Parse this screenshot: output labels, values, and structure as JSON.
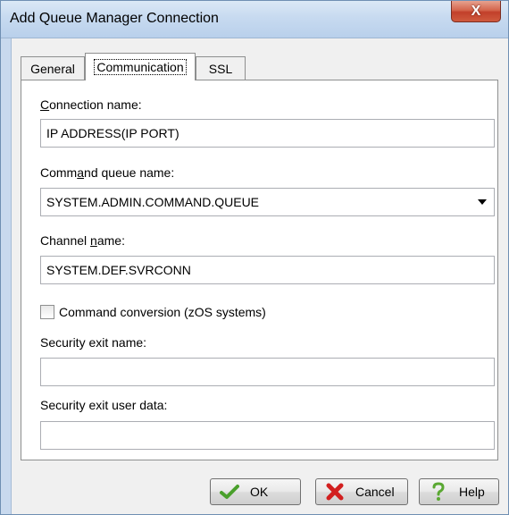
{
  "window": {
    "title": "Add Queue Manager Connection",
    "close_glyph": "X"
  },
  "tabs": [
    {
      "label": "General"
    },
    {
      "label": "Communication",
      "active": true
    },
    {
      "label": "SSL"
    }
  ],
  "form": {
    "connection_name": {
      "label_accel": "C",
      "label_rest": "onnection name:",
      "value": "IP ADDRESS(IP PORT)"
    },
    "command_queue": {
      "label_pre": "Comm",
      "label_accel": "a",
      "label_post": "nd queue name:",
      "value": "SYSTEM.ADMIN.COMMAND.QUEUE"
    },
    "channel_name": {
      "label_pre": "Channel ",
      "label_accel": "n",
      "label_post": "ame:",
      "value": "SYSTEM.DEF.SVRCONN"
    },
    "command_conversion": {
      "label": "Command conversion (zOS systems)",
      "checked": false
    },
    "security_exit_name": {
      "label": "Security exit name:",
      "value": ""
    },
    "security_exit_user_data": {
      "label": "Security exit user data:",
      "value": ""
    }
  },
  "buttons": {
    "ok": {
      "label": "OK",
      "icon": "checkmark-icon"
    },
    "cancel": {
      "label": "Cancel",
      "icon": "red-x-icon"
    },
    "help": {
      "label": "Help",
      "icon": "question-mark-icon"
    }
  },
  "colors": {
    "title_bar": "#c7daf0",
    "close_button": "#c2402a",
    "ok_icon": "#4aa02c",
    "cancel_icon": "#d21f1f",
    "help_icon": "#5aa832"
  }
}
